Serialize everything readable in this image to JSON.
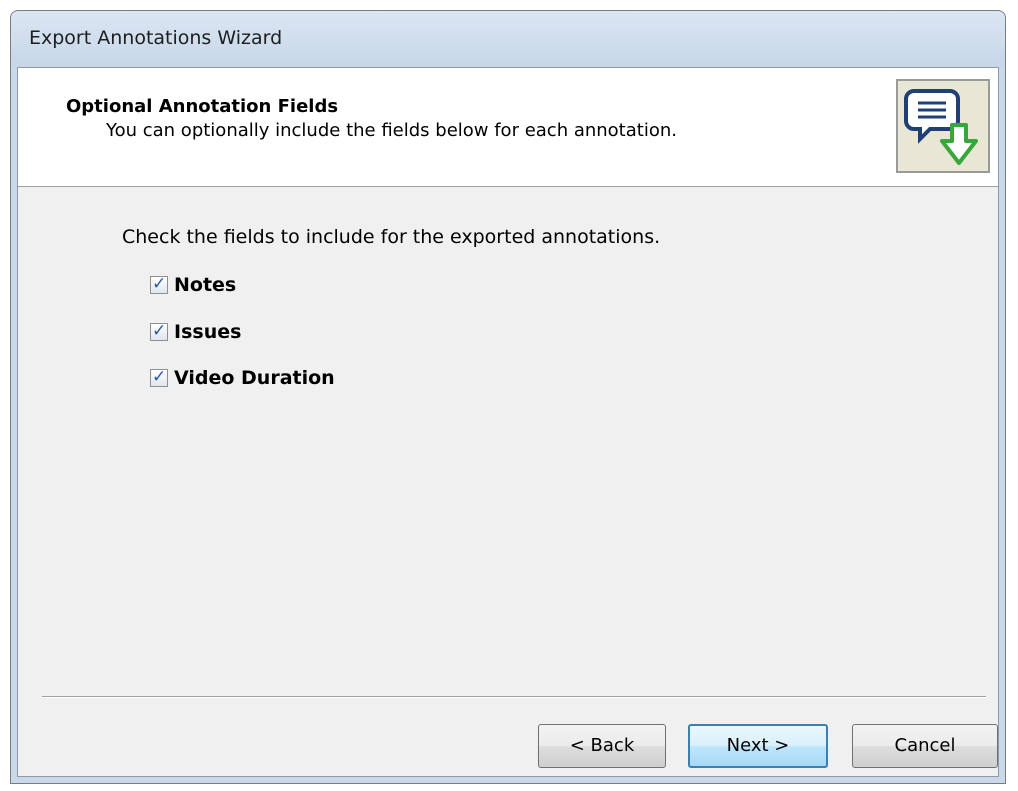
{
  "window": {
    "title": "Export Annotations Wizard"
  },
  "header": {
    "title": "Optional Annotation Fields",
    "subtitle": "You can optionally include the fields below for each annotation.",
    "icon": "annotation-export-icon"
  },
  "body": {
    "intro": "Check the fields to include for the exported annotations.",
    "options": [
      {
        "label": "Notes",
        "checked": true
      },
      {
        "label": "Issues",
        "checked": true
      },
      {
        "label": "Video Duration",
        "checked": true
      }
    ]
  },
  "buttons": {
    "back": "< Back",
    "next": "Next >",
    "cancel": "Cancel"
  },
  "colors": {
    "titlebar": "#c6d6e8",
    "client": "#f0f0f0",
    "default_button_border": "#3c7fb1",
    "icon_arrow": "#3aa63a"
  }
}
